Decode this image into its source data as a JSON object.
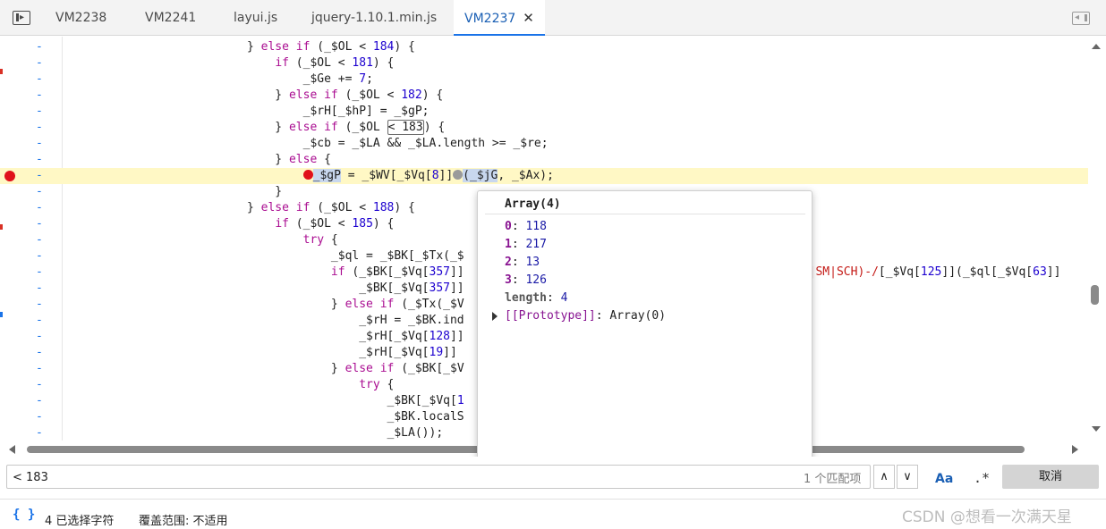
{
  "tabs": [
    {
      "label": "VM2238",
      "active": false
    },
    {
      "label": "VM2241",
      "active": false
    },
    {
      "label": "layui.js",
      "active": false
    },
    {
      "label": "jquery-1.10.1.min.js",
      "active": false
    },
    {
      "label": "VM2237",
      "active": true
    }
  ],
  "tab_close_glyph": "✕",
  "code": {
    "gutter_marker": "-",
    "lines": [
      {
        "pre": "} ",
        "kw": "else if",
        "rest": " (_$OL < ",
        "num": "184",
        "post": ") {"
      },
      {
        "pre": "    ",
        "kw": "if",
        "rest": " (_$OL < ",
        "num": "181",
        "post": ") {"
      },
      {
        "pre": "        _$Ge += ",
        "kw": "",
        "rest": "",
        "num": "7",
        "post": ";"
      },
      {
        "pre": "    } ",
        "kw": "else if",
        "rest": " (_$OL < ",
        "num": "182",
        "post": ") {"
      },
      {
        "pre": "        _$rH[_$hP] = _$gP;",
        "kw": "",
        "rest": "",
        "num": "",
        "post": ""
      },
      {
        "pre": "    } ",
        "kw": "else if",
        "rest": " (_$OL ",
        "num": "",
        "post": ""
      },
      {
        "pre": "        _$cb = _$LA && _$LA.length >= _$re;",
        "kw": "",
        "rest": "",
        "num": "",
        "post": ""
      },
      {
        "pre": "    } ",
        "kw": "else",
        "rest": " {",
        "num": "",
        "post": ""
      },
      {
        "pre": "",
        "kw": "",
        "rest": "",
        "num": "",
        "post": ""
      },
      {
        "pre": "    }",
        "kw": "",
        "rest": "",
        "num": "",
        "post": ""
      },
      {
        "pre": "} ",
        "kw": "else if",
        "rest": " (_$OL < ",
        "num": "188",
        "post": ") {"
      },
      {
        "pre": "    ",
        "kw": "if",
        "rest": " (_$OL < ",
        "num": "185",
        "post": ") {"
      },
      {
        "pre": "        ",
        "kw": "try",
        "rest": " {",
        "num": "",
        "post": ""
      },
      {
        "pre": "            _$ql = _$BK[_$Tx(_$",
        "kw": "",
        "rest": "",
        "num": "",
        "post": ""
      },
      {
        "pre": "            ",
        "kw": "if",
        "rest": " (_$BK[_$Vq[",
        "num": "357",
        "post": "]]"
      },
      {
        "pre": "                _$BK[_$Vq[",
        "kw": "",
        "rest": "",
        "num": "357",
        "post": "]]"
      },
      {
        "pre": "            } ",
        "kw": "else if",
        "rest": " (_$Tx(_$V",
        "num": "",
        "post": ""
      },
      {
        "pre": "                _$rH = _$BK.ind",
        "kw": "",
        "rest": "",
        "num": "",
        "post": ""
      },
      {
        "pre": "                _$rH[_$Vq[",
        "kw": "",
        "rest": "",
        "num": "128",
        "post": "]]"
      },
      {
        "pre": "                _$rH[_$Vq[",
        "kw": "",
        "rest": "",
        "num": "19",
        "post": "]]"
      },
      {
        "pre": "            } ",
        "kw": "else if",
        "rest": " (_$BK[_$V",
        "num": "",
        "post": ""
      },
      {
        "pre": "                ",
        "kw": "try",
        "rest": " {",
        "num": "",
        "post": ""
      },
      {
        "pre": "                    _$BK[_$Vq[",
        "kw": "",
        "rest": "",
        "num": "1",
        "post": ""
      },
      {
        "pre": "                    _$BK.localS",
        "kw": "",
        "rest": "",
        "num": "",
        "post": ""
      },
      {
        "pre": "                    _$LA());",
        "kw": "",
        "rest": "",
        "num": "",
        "post": ""
      }
    ],
    "boxed_line": {
      "search_match": "< 183",
      "after": ") {"
    },
    "exec_line": {
      "indent": "        ",
      "target": "_$gP",
      "mid": " = _$WV[_$Vq[",
      "num": "8",
      "mid2": "]]",
      "arg": "(_$jG",
      "tail": ", _$Ax);"
    },
    "overflow_line": {
      "str": "GT|SM|SCH)-/",
      "rest": "[_$Vq[",
      "num": "125",
      "rest2": "]](_$ql[_$Vq[",
      "num2": "63",
      "rest3": "]]"
    }
  },
  "popover": {
    "title": "Array(4)",
    "entries": [
      {
        "key": "0",
        "value": "118"
      },
      {
        "key": "1",
        "value": "217"
      },
      {
        "key": "2",
        "value": "13"
      },
      {
        "key": "3",
        "value": "126"
      },
      {
        "key": "length",
        "value": "4"
      }
    ],
    "prototype": {
      "key": "[[Prototype]]",
      "value": "Array(0)"
    }
  },
  "search": {
    "value": "< 183",
    "match_count": "1 个匹配项",
    "prev_glyph": "∧",
    "next_glyph": "∨",
    "case_label": "Aa",
    "regex_label": ".*",
    "cancel_label": "取消"
  },
  "status": {
    "braces": "{ }",
    "selected": "4 已选择字符",
    "coverage": "覆盖范围: 不适用",
    "watermark": "CSDN @想看一次满天星"
  }
}
